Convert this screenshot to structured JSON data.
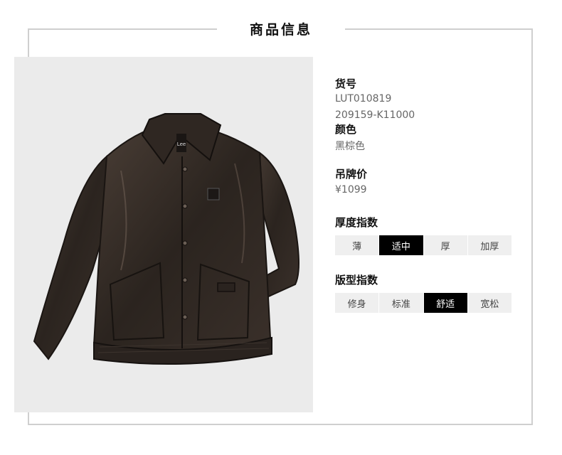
{
  "header": {
    "title": "商品信息"
  },
  "product": {
    "image_alt": "黑棕色皮夹克",
    "brand_tag": "Lee",
    "sku_label": "货号",
    "sku_values": [
      "LUT010819",
      "209159-K11000"
    ],
    "color_label": "颜色",
    "color_value": "黑棕色",
    "price_label": "吊牌价",
    "price_value": "¥1099"
  },
  "thickness": {
    "label": "厚度指数",
    "options": [
      "薄",
      "适中",
      "厚",
      "加厚"
    ],
    "selected_index": 1
  },
  "fit": {
    "label": "版型指数",
    "options": [
      "修身",
      "标准",
      "舒适",
      "宽松"
    ],
    "selected_index": 2
  },
  "colors": {
    "selected_bg": "#000000",
    "unselected_bg": "#efefef",
    "frame": "#cfcfcf"
  }
}
